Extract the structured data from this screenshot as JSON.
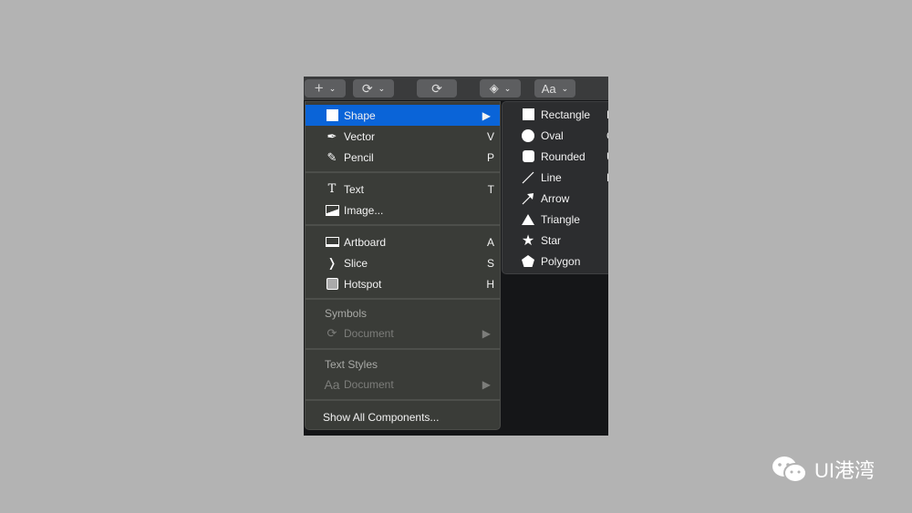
{
  "toolbar": {
    "insert_icon": "+",
    "symbols_icon": "refresh",
    "sync_icon": "refresh",
    "layers_icon": "layers",
    "text_label": "Aa"
  },
  "menu": {
    "items": [
      {
        "label": "Shape",
        "shortcut": "▶",
        "icon": "square"
      },
      {
        "label": "Vector",
        "shortcut": "V",
        "icon": "pen"
      },
      {
        "label": "Pencil",
        "shortcut": "P",
        "icon": "pencil"
      },
      {
        "label": "Text",
        "shortcut": "T",
        "icon": "text"
      },
      {
        "label": "Image...",
        "shortcut": "",
        "icon": "image"
      },
      {
        "label": "Artboard",
        "shortcut": "A",
        "icon": "artboard"
      },
      {
        "label": "Slice",
        "shortcut": "S",
        "icon": "knife"
      },
      {
        "label": "Hotspot",
        "shortcut": "H",
        "icon": "hotspot"
      }
    ],
    "symbols_header": "Symbols",
    "symbols_doc": "Document",
    "text_styles_header": "Text Styles",
    "text_styles_doc": "Document",
    "text_styles_icon": "Aa",
    "show_all": "Show All Components..."
  },
  "submenu": {
    "items": [
      {
        "label": "Rectangle",
        "shortcut": "R"
      },
      {
        "label": "Oval",
        "shortcut": "O"
      },
      {
        "label": "Rounded",
        "shortcut": "U"
      },
      {
        "label": "Line",
        "shortcut": "L"
      },
      {
        "label": "Arrow",
        "shortcut": ""
      },
      {
        "label": "Triangle",
        "shortcut": ""
      },
      {
        "label": "Star",
        "shortcut": ""
      },
      {
        "label": "Polygon",
        "shortcut": ""
      }
    ]
  },
  "watermark": "UI港湾",
  "colors": {
    "highlight": "#0a64d8",
    "menu_bg": "#3a3c38",
    "submenu_bg": "#2c2d2f"
  }
}
